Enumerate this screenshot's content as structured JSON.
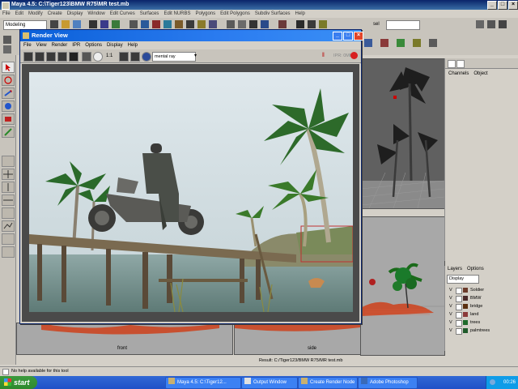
{
  "maya": {
    "title": "Maya 4.5: C:\\Tiger123\\BMW R75\\MR test.mb",
    "menus": [
      "File",
      "Edit",
      "Modify",
      "Create",
      "Display",
      "Window",
      "Edit Curves",
      "Surfaces",
      "Edit NURBS",
      "Polygons",
      "Edit Polygons",
      "Subdiv Surfaces",
      "Help"
    ],
    "mode": "Modeling",
    "sel_label": "sel"
  },
  "render_view": {
    "title": "Render View",
    "menus": [
      "File",
      "View",
      "Render",
      "IPR",
      "Options",
      "Display",
      "Help"
    ],
    "ratio_label": "1:1",
    "renderer": "mental ray",
    "ipr_label": "IPR: 0MB"
  },
  "viewports": {
    "front_label": "front",
    "side_label": "side"
  },
  "channel_box": {
    "tabs": [
      "Channels",
      "Object"
    ]
  },
  "layers": {
    "tabs": [
      "Layers",
      "Options"
    ],
    "display": "Display",
    "items": [
      {
        "v": "V",
        "name": "Soldier",
        "color": "#6b3a2a"
      },
      {
        "v": "V",
        "name": "BMW",
        "color": "#4a2a2a"
      },
      {
        "v": "V",
        "name": "bridge",
        "color": "#5a3010"
      },
      {
        "v": "V",
        "name": "land",
        "color": "#8b3a3a"
      },
      {
        "v": "V",
        "name": "trees",
        "color": "#1e6a2a"
      },
      {
        "v": "V",
        "name": "palmtrees",
        "color": "#1e5a2a"
      }
    ]
  },
  "status": {
    "result": "Result: C:/Tiger123/BMW R75/MR test.mb",
    "help": "No help available for this tool"
  },
  "taskbar": {
    "start": "start",
    "tasks": [
      {
        "label": "Maya 4.5: C:\\Tiger12...",
        "color": "#c8b070"
      },
      {
        "label": "Output Window",
        "color": "#e0e0e0"
      },
      {
        "label": "Create Render Node",
        "color": "#c8b070"
      },
      {
        "label": "Adobe Photoshop",
        "color": "#3a6ab8"
      }
    ],
    "clock": "00:26"
  }
}
